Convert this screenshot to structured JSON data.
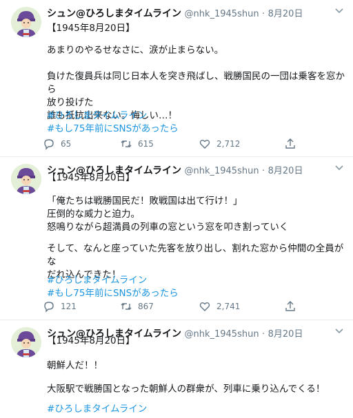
{
  "account": {
    "display_name": "シュン@ひろしまタイムライン",
    "handle": "@nhk_1945shun",
    "dot": "·"
  },
  "tweets": [
    {
      "date": "8月20日",
      "lead": "【1945年8月20日】",
      "paragraphs": [
        "あまりのやるせなさに、涙が止まらない。",
        "負けた復員兵は同じ日本人を突き飛ばし、戦勝国民の一団は乗客を窓から\n放り投げた\n誰も抵抗出来ない。悔しい…！"
      ],
      "hashtags": [
        "#ひろしまタイムライン",
        "#もし75年前にSNSがあったら"
      ],
      "replies": "65",
      "retweets": "615",
      "likes": "2,712"
    },
    {
      "date": "8月20日",
      "lead": "【1945年8月20日】",
      "paragraphs": [
        "「俺たちは戦勝国民だ！敗戦国は出て行け！」\n圧倒的な威力と迫力。\n怒鳴りながら超満員の列車の窓という窓を叩き割っていく",
        "そして、なんと座っていた先客を放り出し、割れた窓から仲間の全員がな\nだれ込んできた！"
      ],
      "hashtags": [
        "#ひろしまタイムライン",
        "#もし75年前にSNSがあったら"
      ],
      "replies": "121",
      "retweets": "867",
      "likes": "2,741"
    },
    {
      "date": "8月20日",
      "lead": "【1945年8月20日】",
      "paragraphs": [
        "朝鮮人だ！！",
        "大阪駅で戦勝国となった朝鮮人の群衆が、列車に乗り込んでくる！"
      ],
      "hashtags": [
        "#ひろしまタイムライン"
      ]
    }
  ],
  "icons": {
    "reply": "reply-icon",
    "retweet": "retweet-icon",
    "like": "heart-icon",
    "share": "share-icon",
    "more": "chevron-down-icon"
  },
  "colors": {
    "hashtag": "#1b95e0",
    "meta": "#657786",
    "divider": "#e6ecf0"
  }
}
